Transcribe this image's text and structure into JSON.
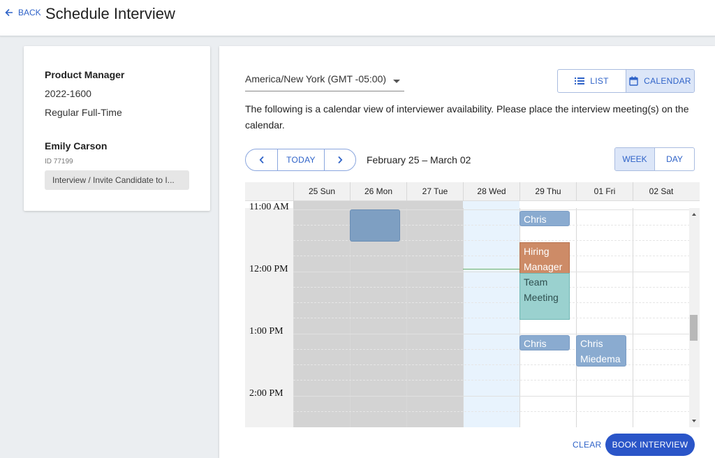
{
  "header": {
    "back_label": "BACK",
    "title": "Schedule Interview"
  },
  "job": {
    "title": "Product Manager",
    "requisition": "2022-1600",
    "employment_type": "Regular Full-Time"
  },
  "candidate": {
    "name": "Emily Carson",
    "id": "ID 77199",
    "stage": "Interview / Invite Candidate to I..."
  },
  "timezone": {
    "selected": "America/New York (GMT -05:00)"
  },
  "view_toggle": {
    "list_label": "LIST",
    "calendar_label": "CALENDAR",
    "active": "calendar"
  },
  "description": "The following is a calendar view of interviewer availability. Please place the interview meeting(s) on the calendar.",
  "navigation": {
    "today_label": "TODAY",
    "date_range": "February 25 – March 02"
  },
  "period_toggle": {
    "week_label": "WEEK",
    "day_label": "DAY",
    "active": "week"
  },
  "calendar": {
    "days": [
      "25 Sun",
      "26 Mon",
      "27 Tue",
      "28 Wed",
      "29 Thu",
      "01 Fri",
      "02 Sat"
    ],
    "today_index": 3,
    "past_through_index": 2,
    "time_labels": [
      "11:00 AM",
      "12:00 PM",
      "1:00 PM",
      "2:00 PM"
    ],
    "events": [
      {
        "day_index": 4,
        "label": "Chris",
        "kind": "interviewer"
      },
      {
        "day_index": 4,
        "label": "Hiring Manager",
        "kind": "hiring-manager"
      },
      {
        "day_index": 4,
        "label": "Team Meeting",
        "kind": "team-meeting"
      },
      {
        "day_index": 4,
        "label": "Chris",
        "kind": "interviewer"
      },
      {
        "day_index": 5,
        "label": "Chris Miedema",
        "kind": "interviewer"
      }
    ],
    "colors": {
      "past": "#d3d3d3",
      "today": "#e8f3fd",
      "interviewer": "#8aabd0",
      "hiring_manager": "#cd8b67",
      "team_meeting": "#9ad1cf",
      "now_line": "#6ab26a"
    }
  },
  "footer": {
    "clear_label": "CLEAR",
    "book_label": "BOOK INTERVIEW"
  },
  "icons": {
    "back": "arrow-left-icon",
    "list": "list-icon",
    "calendar": "calendar-icon",
    "prev": "chevron-left-icon",
    "next": "chevron-right-icon",
    "dropdown": "caret-down-icon"
  }
}
